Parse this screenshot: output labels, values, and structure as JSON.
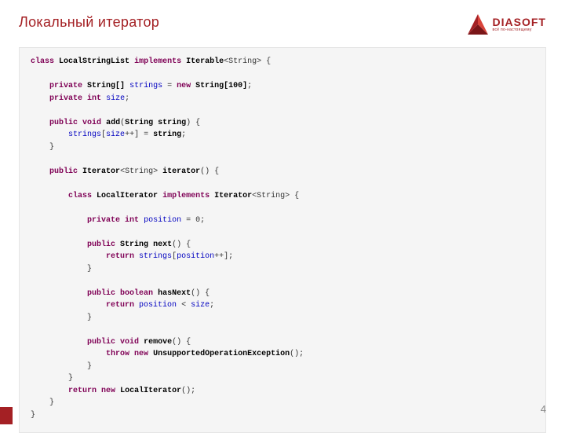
{
  "header": {
    "title": "Локальный итератор",
    "logo_name": "DIASOFT",
    "logo_tag": "всё по-настоящему"
  },
  "code": {
    "l1": {
      "kw1": "class",
      "id1": "LocalStringList",
      "kw2": "implements",
      "id2": "Iterable",
      "gen": "<String>",
      "brace": " {"
    },
    "l2": {
      "kw1": "private",
      "id1": "String[]",
      "id2": "strings",
      "op": " = ",
      "kw2": "new",
      "id3": "String[100]",
      "semi": ";"
    },
    "l3": {
      "kw1": "private",
      "kw2": "int",
      "id1": "size",
      "semi": ";"
    },
    "l4": {
      "kw1": "public",
      "kw2": "void",
      "fn": "add",
      "paren": "(",
      "id1": "String",
      "id2": "string",
      "close": ") {"
    },
    "l5": {
      "id1": "strings",
      "br1": "[",
      "id2": "size",
      "op": "++",
      "br2": "] = ",
      "id3": "string",
      "semi": ";"
    },
    "l6": {
      "brace": "}"
    },
    "l7": {
      "kw1": "public",
      "id1": "Iterator",
      "gen": "<String>",
      "fn": " iterator",
      "paren": "() {"
    },
    "l8": {
      "kw1": "class",
      "id1": "LocalIterator",
      "kw2": "implements",
      "id2": "Iterator",
      "gen": "<String>",
      "brace": " {"
    },
    "l9": {
      "kw1": "private",
      "kw2": "int",
      "id1": "position",
      "op": " = ",
      "num": "0",
      "semi": ";"
    },
    "l10": {
      "kw1": "public",
      "id1": "String",
      "fn": " next",
      "paren": "() {"
    },
    "l11": {
      "kw1": "return",
      "id1": "strings",
      "br1": "[",
      "id2": "position",
      "op": "++",
      "br2": "];"
    },
    "l12": {
      "brace": "}"
    },
    "l13": {
      "kw1": "public",
      "kw2": "boolean",
      "fn": " hasNext",
      "paren": "() {"
    },
    "l14": {
      "kw1": "return",
      "id1": "position",
      "op": " < ",
      "id2": "size",
      "semi": ";"
    },
    "l15": {
      "brace": "}"
    },
    "l16": {
      "kw1": "public",
      "kw2": "void",
      "fn": " remove",
      "paren": "() {"
    },
    "l17": {
      "kw1": "throw",
      "kw2": "new",
      "id1": "UnsupportedOperationException",
      "paren": "();"
    },
    "l18": {
      "brace": "}"
    },
    "l19": {
      "brace": "}"
    },
    "l20": {
      "kw1": "return",
      "kw2": "new",
      "id1": "LocalIterator",
      "paren": "();"
    },
    "l21": {
      "brace": "}"
    },
    "l22": {
      "brace": "}"
    }
  },
  "page_number": "4"
}
